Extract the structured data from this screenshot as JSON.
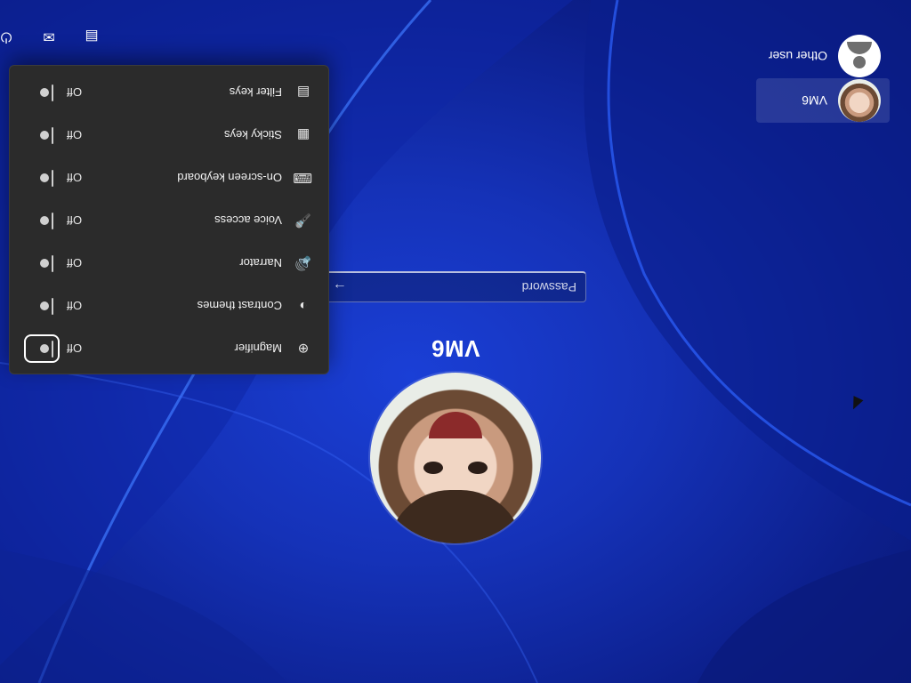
{
  "screen": {
    "rotation_degrees": 180,
    "accent_color": "#1532b8"
  },
  "user_main": {
    "name": "VM6"
  },
  "password": {
    "placeholder": "Password",
    "submit_icon": "arrow-right-icon"
  },
  "users": [
    {
      "name": "VM6",
      "avatar": "photo-avatar",
      "selected": true
    },
    {
      "name": "Other user",
      "avatar": "generic-user-icon",
      "selected": false
    }
  ],
  "accessibility": {
    "items": [
      {
        "label": "Magnifier",
        "state": "Off",
        "icon": "magnifier-icon",
        "focused": true
      },
      {
        "label": "Contrast themes",
        "state": "Off",
        "icon": "contrast-icon",
        "focused": false
      },
      {
        "label": "Narrator",
        "state": "Off",
        "icon": "narrator-icon",
        "focused": false
      },
      {
        "label": "Voice access",
        "state": "Off",
        "icon": "voice-access-icon",
        "focused": false
      },
      {
        "label": "On-screen keyboard",
        "state": "Off",
        "icon": "keyboard-icon",
        "focused": false
      },
      {
        "label": "Sticky keys",
        "state": "Off",
        "icon": "sticky-keys-icon",
        "focused": false
      },
      {
        "label": "Filter keys",
        "state": "Off",
        "icon": "filter-keys-icon",
        "focused": false
      }
    ]
  },
  "tray": [
    {
      "icon": "network-icon"
    },
    {
      "icon": "accessibility-icon"
    },
    {
      "icon": "power-icon"
    }
  ]
}
